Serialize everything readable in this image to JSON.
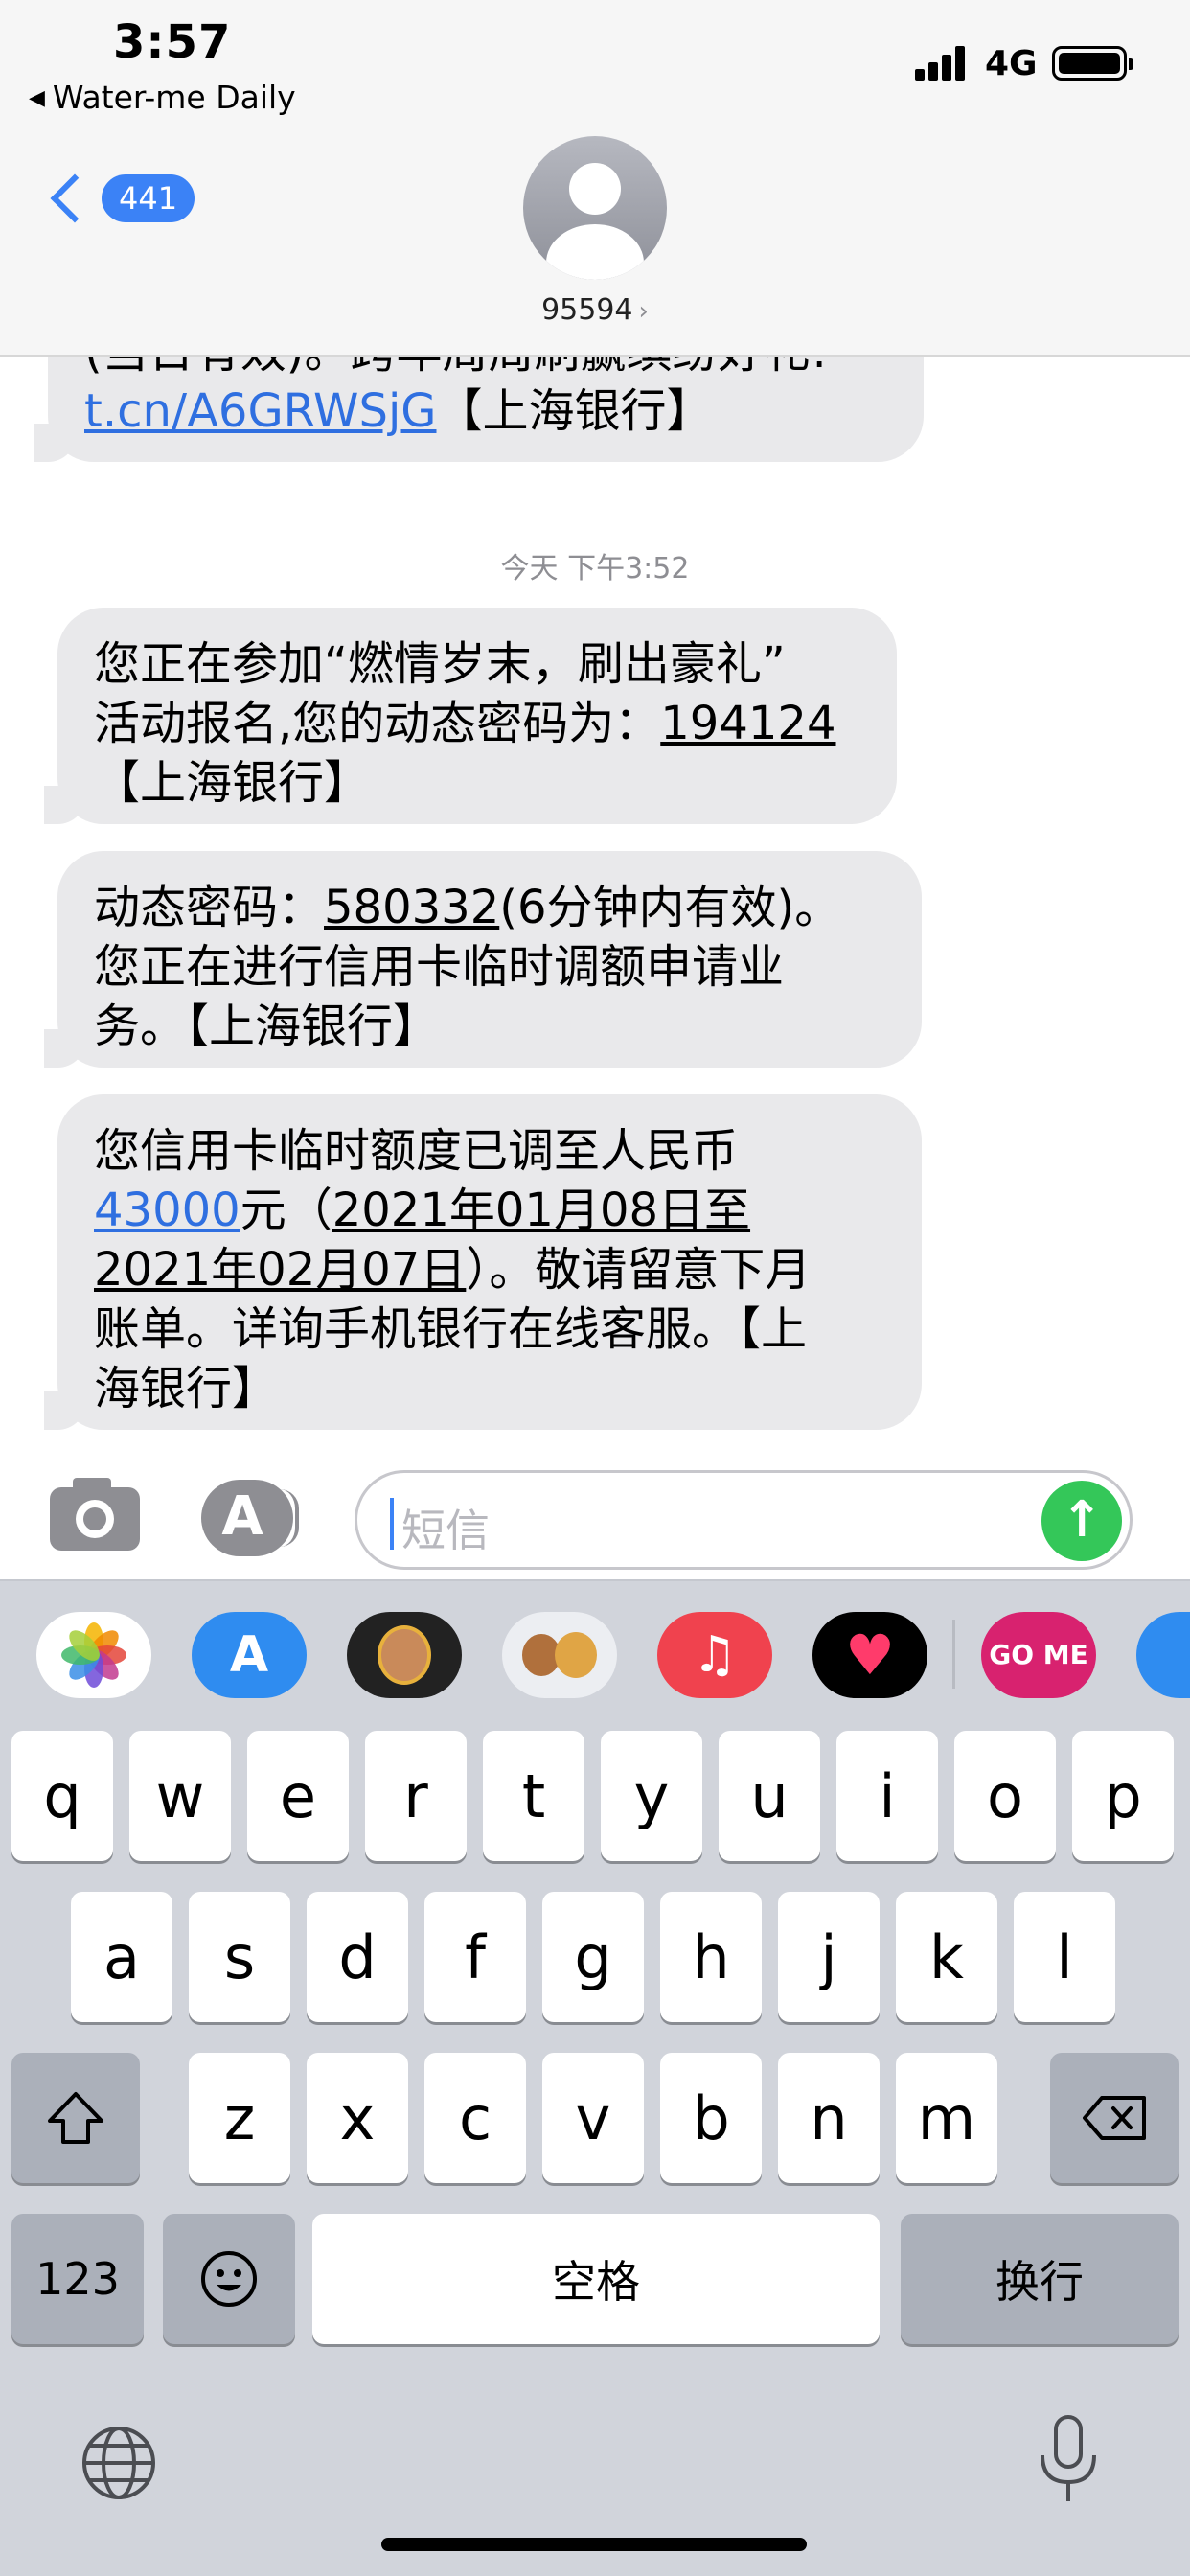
{
  "status_bar": {
    "time": "3:57",
    "back_app": "Water-me Daily",
    "network": "4G"
  },
  "header": {
    "unread_count": "441",
    "contact": "95594"
  },
  "messages": {
    "partial_top": {
      "lines": [
        "(当日有效)。跨年周周刷赢缤纷好礼!"
      ],
      "link": "t.cn/A6GRWSjG",
      "after_link": "【上海银行】"
    },
    "timestamp": "今天 下午3:52",
    "msg1": {
      "line1": "您正在参加“燃情岁末，刷出豪礼”",
      "line2_pre": "活动报名,您的动态密码为：",
      "line2_code": "194124",
      "line3": "【上海银行】"
    },
    "msg2": {
      "line1_pre": "动态密码：",
      "line1_code": "580332",
      "line1_post": "(6分钟内有效)。",
      "line2": "您正在进行信用卡临时调额申请业",
      "line3": "务。【上海银行】"
    },
    "msg3": {
      "line1": "您信用卡临时额度已调至人民币",
      "line2_amount": "43000",
      "line2_mid": "元（",
      "line2_date": "2021年01月08日至",
      "line3_date": "2021年02月07日",
      "line3_post": "）。敬请留意下月",
      "line4": "账单。详询手机银行在线客服。【上",
      "line5": "海银行】"
    }
  },
  "input": {
    "placeholder": "短信"
  },
  "app_tray": [
    "photos-icon",
    "app-store-icon",
    "memoji-icon",
    "animoji-icon",
    "music-icon",
    "digital-touch-icon",
    "gome-icon",
    "app-store-icon-2"
  ],
  "tray_text": {
    "gome": "GO ME"
  },
  "keyboard": {
    "row1": [
      "q",
      "w",
      "e",
      "r",
      "t",
      "y",
      "u",
      "i",
      "o",
      "p"
    ],
    "row2": [
      "a",
      "s",
      "d",
      "f",
      "g",
      "h",
      "j",
      "k",
      "l"
    ],
    "row3": [
      "z",
      "x",
      "c",
      "v",
      "b",
      "n",
      "m"
    ],
    "numbers_label": "123",
    "space_label": "空格",
    "return_label": "换行"
  },
  "colors": {
    "accent": "#3b82f6",
    "bubble": "#e9e9eb",
    "send": "#34c759",
    "keyboard_bg": "#d1d4db"
  }
}
